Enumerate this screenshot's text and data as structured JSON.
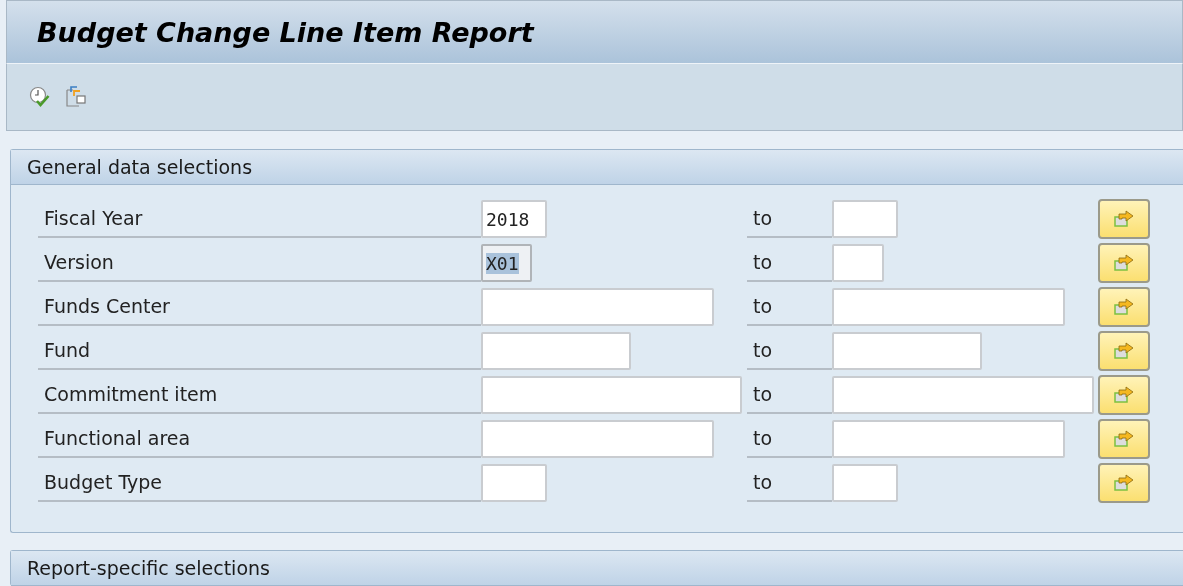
{
  "window": {
    "title": "Budget Change Line Item Report"
  },
  "toolbar": {
    "buttons": [
      {
        "kind": "execute"
      },
      {
        "kind": "variants"
      }
    ]
  },
  "sections": [
    {
      "title": "General data selections",
      "rows": [
        {
          "label": "Fiscal Year",
          "from": {
            "value": "2018",
            "selected": false
          },
          "to_label": "to"
        },
        {
          "label": "Version",
          "from": {
            "value": "X01",
            "selected": true
          },
          "to_label": "to"
        },
        {
          "label": "Funds Center",
          "to_label": "to"
        },
        {
          "label": "Fund",
          "to_label": "to"
        },
        {
          "label": "Commitment item",
          "to_label": "to"
        },
        {
          "label": "Functional area",
          "to_label": "to"
        },
        {
          "label": "Budget Type",
          "to_label": "to"
        }
      ]
    },
    {
      "title": "Report-specific selections"
    }
  ]
}
